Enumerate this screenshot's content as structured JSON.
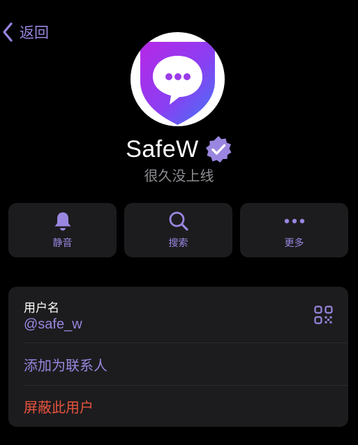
{
  "nav": {
    "back_label": "返回"
  },
  "profile": {
    "name": "SafeW",
    "status": "很久没上线",
    "verified": true,
    "avatar_icon": "shield-chat-icon"
  },
  "actions": [
    {
      "label": "静音",
      "icon": "bell-icon"
    },
    {
      "label": "搜索",
      "icon": "search-icon"
    },
    {
      "label": "更多",
      "icon": "more-icon"
    }
  ],
  "info": {
    "username_label": "用户名",
    "username_value": "@safe_w",
    "qr_icon": "qr-code-icon",
    "add_contact": "添加为联系人",
    "block_user": "屏蔽此用户"
  },
  "colors": {
    "background": "#000000",
    "card": "#1c1c1e",
    "accent": "#9a86e0",
    "danger": "#e9533d",
    "secondary_text": "#8e8e93"
  }
}
